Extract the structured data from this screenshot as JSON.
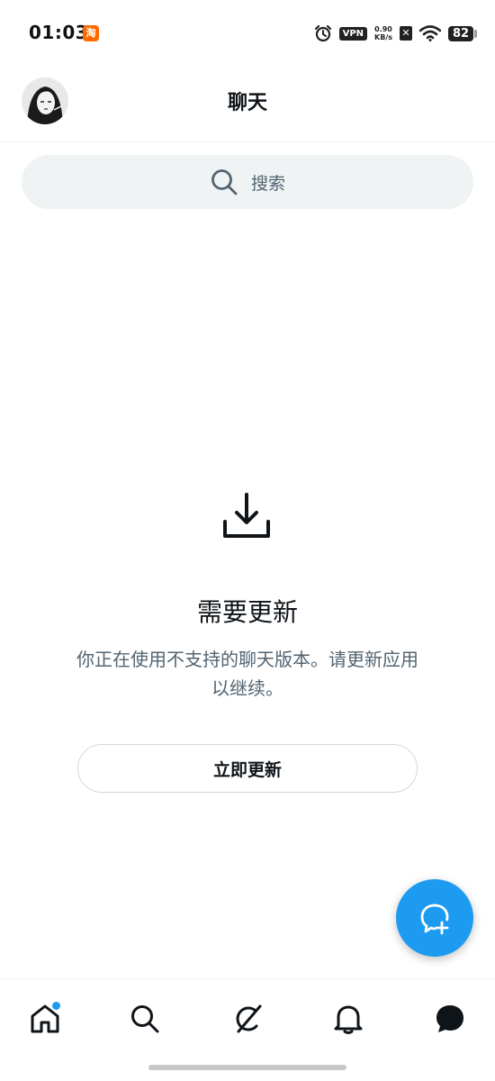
{
  "status_bar": {
    "time": "01:03",
    "taobao_label": "淘",
    "vpn_label": "VPN",
    "speed_value": "0.90",
    "speed_unit": "KB/s",
    "sim_label": "✕",
    "battery": "82"
  },
  "header": {
    "title": "聊天"
  },
  "search": {
    "placeholder": "搜索"
  },
  "empty_state": {
    "title": "需要更新",
    "description": "你正在使用不支持的聊天版本。请更新应用以继续。",
    "button_label": "立即更新"
  },
  "bottom_nav": {
    "items": [
      {
        "icon": "home-icon",
        "active": false,
        "badge": true
      },
      {
        "icon": "search-icon",
        "active": false
      },
      {
        "icon": "grok-icon",
        "active": false
      },
      {
        "icon": "bell-icon",
        "active": false
      },
      {
        "icon": "messages-icon",
        "active": true
      }
    ]
  },
  "colors": {
    "accent": "#1d9bf0",
    "text_primary": "#0f1419",
    "text_secondary": "#536471",
    "search_bg": "#eff3f4"
  }
}
